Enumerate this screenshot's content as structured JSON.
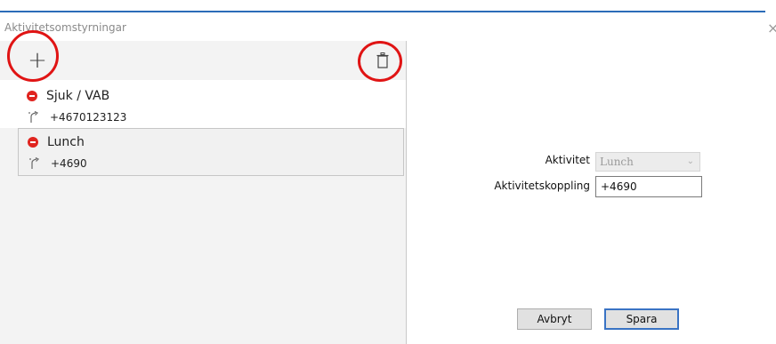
{
  "window": {
    "title": "Aktivitetsomstyrningar",
    "close_glyph": "×"
  },
  "toolbar": {
    "add_glyph": "+",
    "add_icon": "plus-icon",
    "delete_icon": "trash-icon"
  },
  "list": {
    "items": [
      {
        "name": "Sjuk / VAB",
        "number": "+4670123123",
        "status_icon": "stop-icon",
        "route_icon": "route-icon",
        "selected": false
      },
      {
        "name": "Lunch",
        "number": "+4690",
        "status_icon": "stop-icon",
        "route_icon": "route-icon",
        "selected": true
      }
    ]
  },
  "detail": {
    "activity_label": "Aktivitet",
    "activity_value": "Lunch",
    "binding_label": "Aktivitetskoppling",
    "binding_value": "+4690"
  },
  "buttons": {
    "cancel": "Avbryt",
    "save": "Spara"
  },
  "colors": {
    "accent": "#3a73c4",
    "highlight_ring": "#e01414",
    "stop": "#e0241f"
  }
}
